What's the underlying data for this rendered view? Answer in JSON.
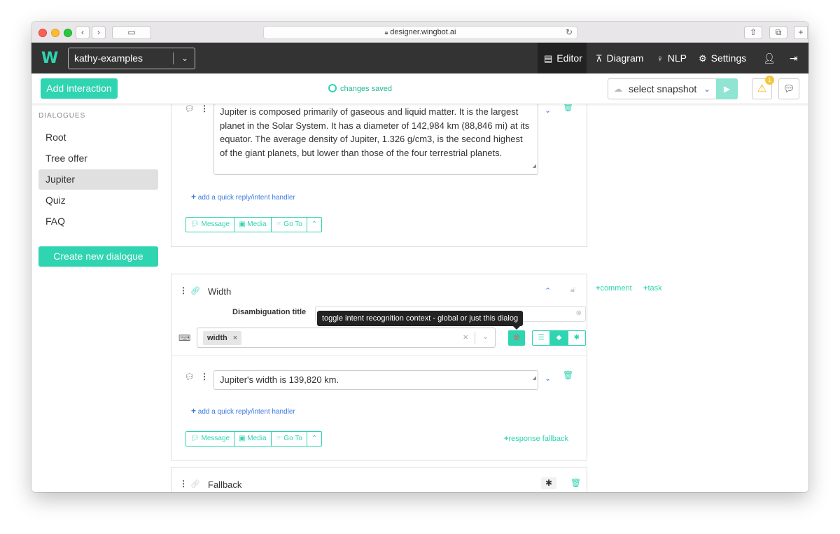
{
  "browser": {
    "url": "designer.wingbot.ai"
  },
  "navbar": {
    "logo": "w",
    "project": "kathy-examples",
    "items": [
      {
        "label": "Editor",
        "icon": "editor-icon"
      },
      {
        "label": "Diagram",
        "icon": "diagram-icon"
      },
      {
        "label": "NLP",
        "icon": "bulb-icon"
      },
      {
        "label": "Settings",
        "icon": "gears-icon"
      }
    ]
  },
  "toolbar": {
    "add_interaction": "Add interaction",
    "status": "changes saved",
    "snapshot_placeholder": "select snapshot",
    "warning_count": "1"
  },
  "sidebar": {
    "title": "DIALOGUES",
    "items": [
      "Root",
      "Tree offer",
      "Jupiter",
      "Quiz",
      "FAQ"
    ],
    "active": "Jupiter",
    "create_button": "Create new dialogue"
  },
  "card1": {
    "message_text": "Jupiter is composed primarily of gaseous and liquid matter. It is the largest planet in the Solar System. It has a diameter of 142,984 km (88,846 mi) at its equator. The average density of Jupiter, 1.326 g/cm3, is the second highest of the giant planets, but lower than those of the four terrestrial planets.",
    "add_quick_reply": "add a quick reply/intent handler",
    "buttons": [
      "Message",
      "Media",
      "Go To"
    ]
  },
  "card2": {
    "title": "Width",
    "disambiguation_label": "Disambiguation title",
    "tooltip": "toggle intent recognition context - global or just this dialog",
    "intent_tag": "width",
    "message_text": "Jupiter's width is 139,820 km.",
    "add_quick_reply": "add a quick reply/intent handler",
    "buttons": [
      "Message",
      "Media",
      "Go To"
    ],
    "response_fallback": "response fallback",
    "comment": "comment",
    "task": "task"
  },
  "card3": {
    "title": "Fallback"
  },
  "colors": {
    "accent": "#2fd4b0",
    "navbar": "#333333",
    "link": "#3c7ae0"
  }
}
